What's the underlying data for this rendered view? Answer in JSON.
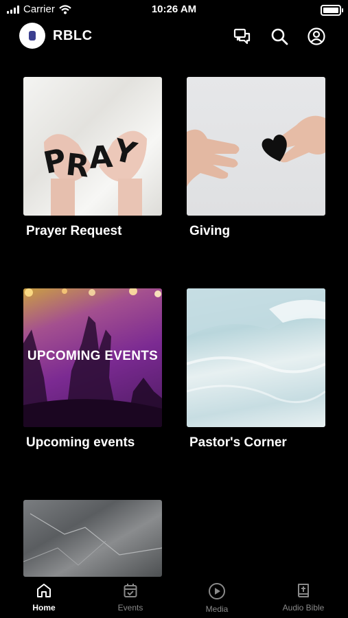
{
  "status_bar": {
    "carrier": "Carrier",
    "time": "10:26 AM"
  },
  "header": {
    "title": "RBLC"
  },
  "tiles": [
    {
      "label": "Prayer Request",
      "image_text": "PRAY"
    },
    {
      "label": "Giving"
    },
    {
      "label": "Upcoming events",
      "image_text": "UPCOMING EVENTS"
    },
    {
      "label": "Pastor's Corner"
    },
    {
      "label": ""
    }
  ],
  "tabbar": {
    "items": [
      {
        "label": "Home",
        "icon": "home-icon",
        "active": true
      },
      {
        "label": "Events",
        "icon": "calendar-icon",
        "active": false
      },
      {
        "label": "Media",
        "icon": "play-icon",
        "active": false
      },
      {
        "label": "Audio Bible",
        "icon": "bible-icon",
        "active": false
      }
    ]
  },
  "colors": {
    "background": "#000000",
    "text": "#ffffff",
    "inactive_tab": "#8a8a8a"
  }
}
